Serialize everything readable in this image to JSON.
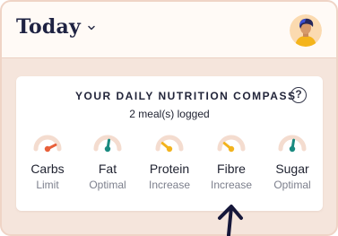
{
  "header": {
    "title": "Today"
  },
  "compass": {
    "title": "YOUR DAILY NUTRITION COMPASS",
    "help_glyph": "?",
    "subtitle": "2 meal(s) logged",
    "gauges": [
      {
        "label": "Carbs",
        "status": "Limit",
        "level": 0.85,
        "color": "#e8603a"
      },
      {
        "label": "Fat",
        "status": "Optimal",
        "level": 0.55,
        "color": "#1a8a80"
      },
      {
        "label": "Protein",
        "status": "Increase",
        "level": 0.22,
        "color": "#f2b31e"
      },
      {
        "label": "Fibre",
        "status": "Increase",
        "level": 0.22,
        "color": "#f2b31e"
      },
      {
        "label": "Sugar",
        "status": "Optimal",
        "level": 0.55,
        "color": "#1a8a80"
      }
    ]
  },
  "colors": {
    "title": "#1e2242",
    "frame_bg": "#f5e5dc",
    "gauge_track": "#f4dccf"
  }
}
